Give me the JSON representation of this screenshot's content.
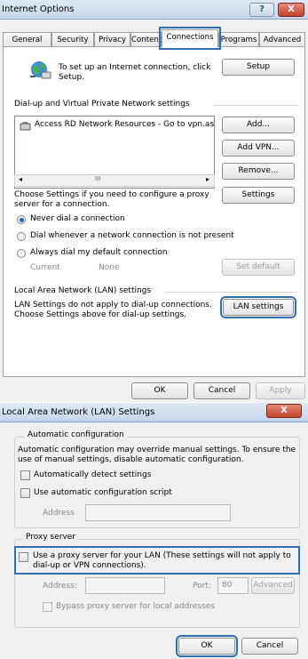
{
  "internet_options": {
    "title": "Internet Options",
    "help_label": "?",
    "close_label": "X",
    "tabs": [
      {
        "label": "General"
      },
      {
        "label": "Security"
      },
      {
        "label": "Privacy"
      },
      {
        "label": "Content"
      },
      {
        "label": "Connections"
      },
      {
        "label": "Programs"
      },
      {
        "label": "Advanced"
      }
    ],
    "active_tab": "Connections",
    "setup_text": "To set up an Internet connection, click Setup.",
    "setup_button": "Setup",
    "dialup_section_label": "Dial-up and Virtual Private Network settings",
    "dialup_list_item": "Access RD Network Resources - Go to vpn.as",
    "add_button": "Add...",
    "add_vpn_button": "Add VPN...",
    "remove_button": "Remove...",
    "scroll_grip": "III",
    "proxy_settings_text": "Choose Settings if you need to configure a proxy server for a connection.",
    "settings_button": "Settings",
    "radio_never": "Never dial a connection",
    "radio_whenever": "Dial whenever a network connection is not present",
    "radio_always": "Always dial my default connection",
    "selected_radio": "Never dial a connection",
    "current_label": "Current",
    "current_value": "None",
    "set_default_button": "Set default",
    "lan_section_label": "Local Area Network (LAN) settings",
    "lan_text": "LAN Settings do not apply to dial-up connections. Choose Settings above for dial-up settings.",
    "lan_settings_button": "LAN settings",
    "ok_button": "OK",
    "cancel_button": "Cancel",
    "apply_button": "Apply"
  },
  "lan_settings": {
    "title": "Local Area Network (LAN) Settings",
    "close_label": "X",
    "auto_config_group": "Automatic configuration",
    "auto_config_text": "Automatic configuration may override manual settings. To ensure the use of manual settings, disable automatic configuration.",
    "auto_detect_label": "Automatically detect settings",
    "auto_script_label": "Use automatic configuration script",
    "address_label": "Address",
    "address_value": "",
    "proxy_group": "Proxy server",
    "use_proxy_label": "Use a proxy server for your LAN (These settings will not apply to dial-up or VPN connections).",
    "proxy_address_label": "Address:",
    "proxy_address_value": "",
    "port_label": "Port:",
    "port_value": "80",
    "advanced_button": "Advanced",
    "bypass_label": "Bypass proxy server for local addresses",
    "ok_button": "OK",
    "cancel_button": "Cancel",
    "auto_detect_checked": false,
    "auto_script_checked": false,
    "use_proxy_checked": false,
    "bypass_checked": false
  },
  "colors": {
    "highlight_outline": "#2f6fb5",
    "radio_selected": "#1f63c6",
    "close_button": "#c1412a"
  }
}
